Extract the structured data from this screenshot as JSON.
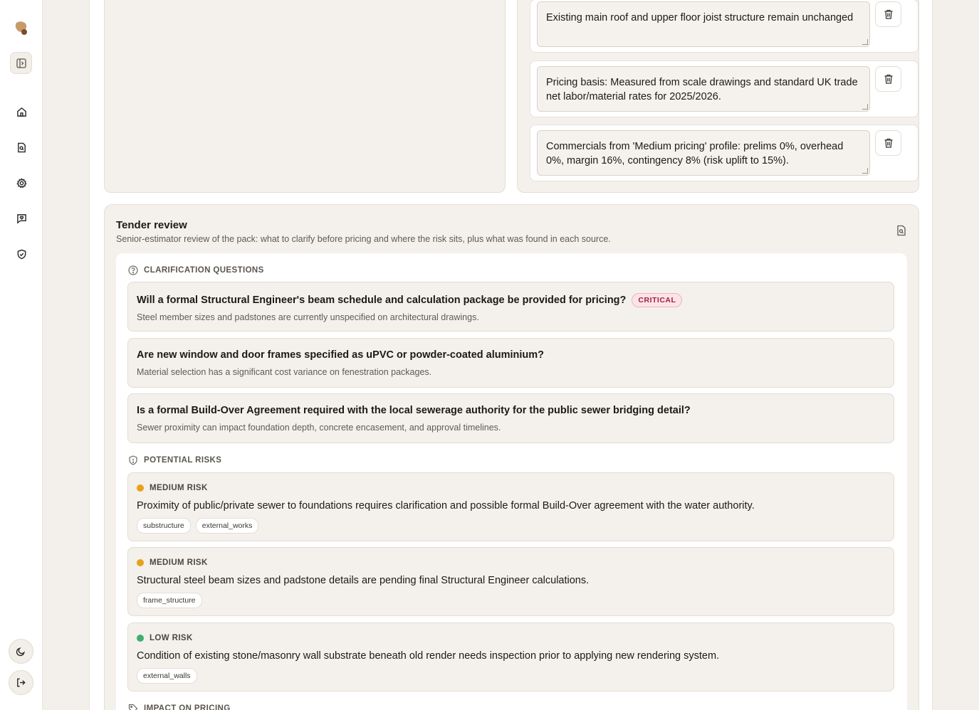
{
  "notes": [
    "Existing main roof and upper floor joist structure remain unchanged",
    "Pricing basis: Measured from scale drawings and standard UK trade net labor/material rates for 2025/2026.",
    "Commercials from 'Medium pricing' profile: prelims 0%, overhead 0%, margin 16%, contingency 8% (risk uplift to 15%)."
  ],
  "tender_review": {
    "title": "Tender review",
    "subtitle": "Senior-estimator review of the pack: what to clarify before pricing and where the risk sits, plus what was found in each source.",
    "clarification_heading": "CLARIFICATION QUESTIONS",
    "questions": [
      {
        "question": "Will a formal Structural Engineer's beam schedule and calculation package be provided for pricing?",
        "badge": "CRITICAL",
        "detail": "Steel member sizes and padstones are currently unspecified on architectural drawings."
      },
      {
        "question": "Are new window and door frames specified as uPVC or powder-coated aluminium?",
        "badge": "",
        "detail": "Material selection has a significant cost variance on fenestration packages."
      },
      {
        "question": "Is a formal Build-Over Agreement required with the local sewerage authority for the public sewer bridging detail?",
        "badge": "",
        "detail": "Sewer proximity can impact foundation depth, concrete encasement, and approval timelines."
      }
    ],
    "risks_heading": "POTENTIAL RISKS",
    "risks": [
      {
        "level": "MEDIUM RISK",
        "color": "#e8a11c",
        "text": "Proximity of public/private sewer to foundations requires clarification and possible formal Build-Over agreement with the water authority.",
        "tags": [
          "substructure",
          "external_works"
        ]
      },
      {
        "level": "MEDIUM RISK",
        "color": "#e8a11c",
        "text": "Structural steel beam sizes and padstone details are pending final Structural Engineer calculations.",
        "tags": [
          "frame_structure"
        ]
      },
      {
        "level": "LOW RISK",
        "color": "#3fae6f",
        "text": "Condition of existing stone/masonry wall substrate beneath old render needs inspection prior to applying new rendering system.",
        "tags": [
          "external_walls"
        ]
      }
    ],
    "impact_heading": "IMPACT ON PRICING"
  }
}
